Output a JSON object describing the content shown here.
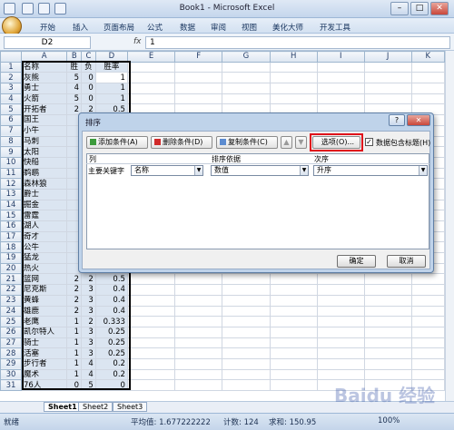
{
  "window": {
    "title": "Book1 - Microsoft Excel",
    "min": "–",
    "max": "□",
    "close": "✕"
  },
  "ribbon_tabs": [
    "开始",
    "插入",
    "页面布局",
    "公式",
    "数据",
    "审阅",
    "视图",
    "美化大师",
    "开发工具"
  ],
  "formula_bar": {
    "name_box": "D2",
    "fx": "fx",
    "value": "1"
  },
  "columns": [
    "",
    "A",
    "B",
    "C",
    "D",
    "E",
    "F",
    "G",
    "H",
    "I",
    "J",
    "K"
  ],
  "rows": [
    [
      "1",
      "名称",
      "胜",
      "负",
      "胜率"
    ],
    [
      "2",
      "灰熊",
      "5",
      "0",
      "1"
    ],
    [
      "3",
      "勇士",
      "4",
      "0",
      "1"
    ],
    [
      "4",
      "火箭",
      "5",
      "0",
      "1"
    ],
    [
      "5",
      "开拓者",
      "2",
      "2",
      "0.5"
    ],
    [
      "6",
      "国王",
      "",
      "",
      ""
    ],
    [
      "7",
      "小牛",
      "",
      "",
      ""
    ],
    [
      "8",
      "马刺",
      "",
      "",
      ""
    ],
    [
      "9",
      "太阳",
      "",
      "",
      ""
    ],
    [
      "10",
      "快船",
      "",
      "",
      ""
    ],
    [
      "11",
      "鹈鹕",
      "",
      "",
      ""
    ],
    [
      "12",
      "森林狼",
      "",
      "",
      ""
    ],
    [
      "13",
      "爵士",
      "",
      "",
      ""
    ],
    [
      "14",
      "掘金",
      "",
      "",
      ""
    ],
    [
      "15",
      "雷霆",
      "",
      "",
      ""
    ],
    [
      "16",
      "湖人",
      "",
      "",
      ""
    ],
    [
      "17",
      "奇才",
      "",
      "",
      ""
    ],
    [
      "18",
      "公牛",
      "",
      "",
      ""
    ],
    [
      "19",
      "猛龙",
      "",
      "",
      ""
    ],
    [
      "20",
      "热火",
      "",
      "",
      ""
    ],
    [
      "21",
      "篮网",
      "2",
      "2",
      "0.5"
    ],
    [
      "22",
      "尼克斯",
      "2",
      "3",
      "0.4"
    ],
    [
      "23",
      "黄蜂",
      "2",
      "3",
      "0.4"
    ],
    [
      "24",
      "雄鹿",
      "2",
      "3",
      "0.4"
    ],
    [
      "25",
      "老鹰",
      "1",
      "2",
      "0.333"
    ],
    [
      "26",
      "凯尔特人",
      "1",
      "3",
      "0.25"
    ],
    [
      "27",
      "骑士",
      "1",
      "3",
      "0.25"
    ],
    [
      "28",
      "活塞",
      "1",
      "3",
      "0.25"
    ],
    [
      "29",
      "步行者",
      "1",
      "4",
      "0.2"
    ],
    [
      "30",
      "魔术",
      "1",
      "4",
      "0.2"
    ],
    [
      "31",
      "76人",
      "0",
      "5",
      "0"
    ]
  ],
  "sheet_tabs": [
    "Sheet1",
    "Sheet2",
    "Sheet3"
  ],
  "status": {
    "mode": "就绪",
    "average": "平均值: 1.677222222",
    "count": "计数: 124",
    "sum": "求和: 150.95",
    "zoom": "100%"
  },
  "sort_dialog": {
    "title": "排序",
    "help": "?",
    "close": "✕",
    "add_level": "添加条件(A)",
    "delete_level": "删除条件(D)",
    "copy_level": "复制条件(C)",
    "options": "选项(O)...",
    "header_checkbox": "数据包含标题(H)",
    "col_header": "列",
    "sort_on_header": "排序依据",
    "order_header": "次序",
    "row_label": "主要关键字",
    "column_value": "名称",
    "sort_on_value": "数值",
    "order_value": "升序",
    "ok": "确定",
    "cancel": "取消"
  },
  "watermark": "Baidu 经验"
}
